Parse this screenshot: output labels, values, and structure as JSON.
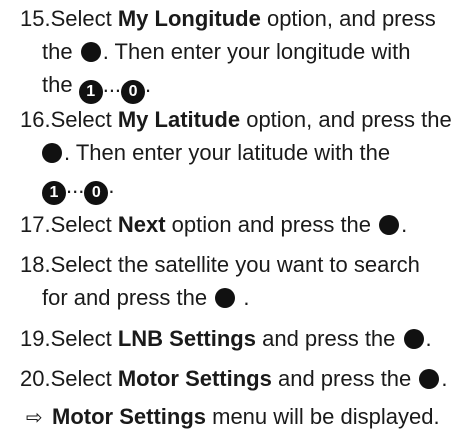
{
  "steps": [
    {
      "number": "15.",
      "lines": [
        [
          "Select ",
          "My Longitude",
          " option, and press"
        ],
        [
          "the ",
          "",
          ". Then enter your longitude with"
        ],
        [
          "the ",
          "1",
          "...",
          "0",
          "."
        ]
      ]
    },
    {
      "number": "16.",
      "lines": [
        [
          "Select ",
          "My Latitude",
          " option, and press the"
        ],
        [
          "",
          ". Then enter your latitude with the"
        ],
        [
          "1",
          "...",
          "0",
          "."
        ]
      ]
    },
    {
      "number": "17.",
      "lines": [
        [
          "Select ",
          "Next",
          " option and press the ",
          "."
        ]
      ]
    },
    {
      "number": "18.",
      "lines": [
        [
          "Select the satellite you want to search"
        ],
        [
          "for and press the ",
          " ."
        ]
      ]
    },
    {
      "number": "19.",
      "lines": [
        [
          "Select ",
          "LNB Settings",
          " and press the ",
          "."
        ]
      ]
    },
    {
      "number": "20.",
      "lines": [
        [
          "Select ",
          "Motor Settings",
          " and press the ",
          "."
        ]
      ]
    }
  ],
  "result": {
    "arrow": "⇨",
    "bold": "Motor Settings",
    "text": " menu will be displayed."
  },
  "icons": {
    "ok_button": "filled-black-circle",
    "key_1": "1",
    "key_0": "0"
  }
}
